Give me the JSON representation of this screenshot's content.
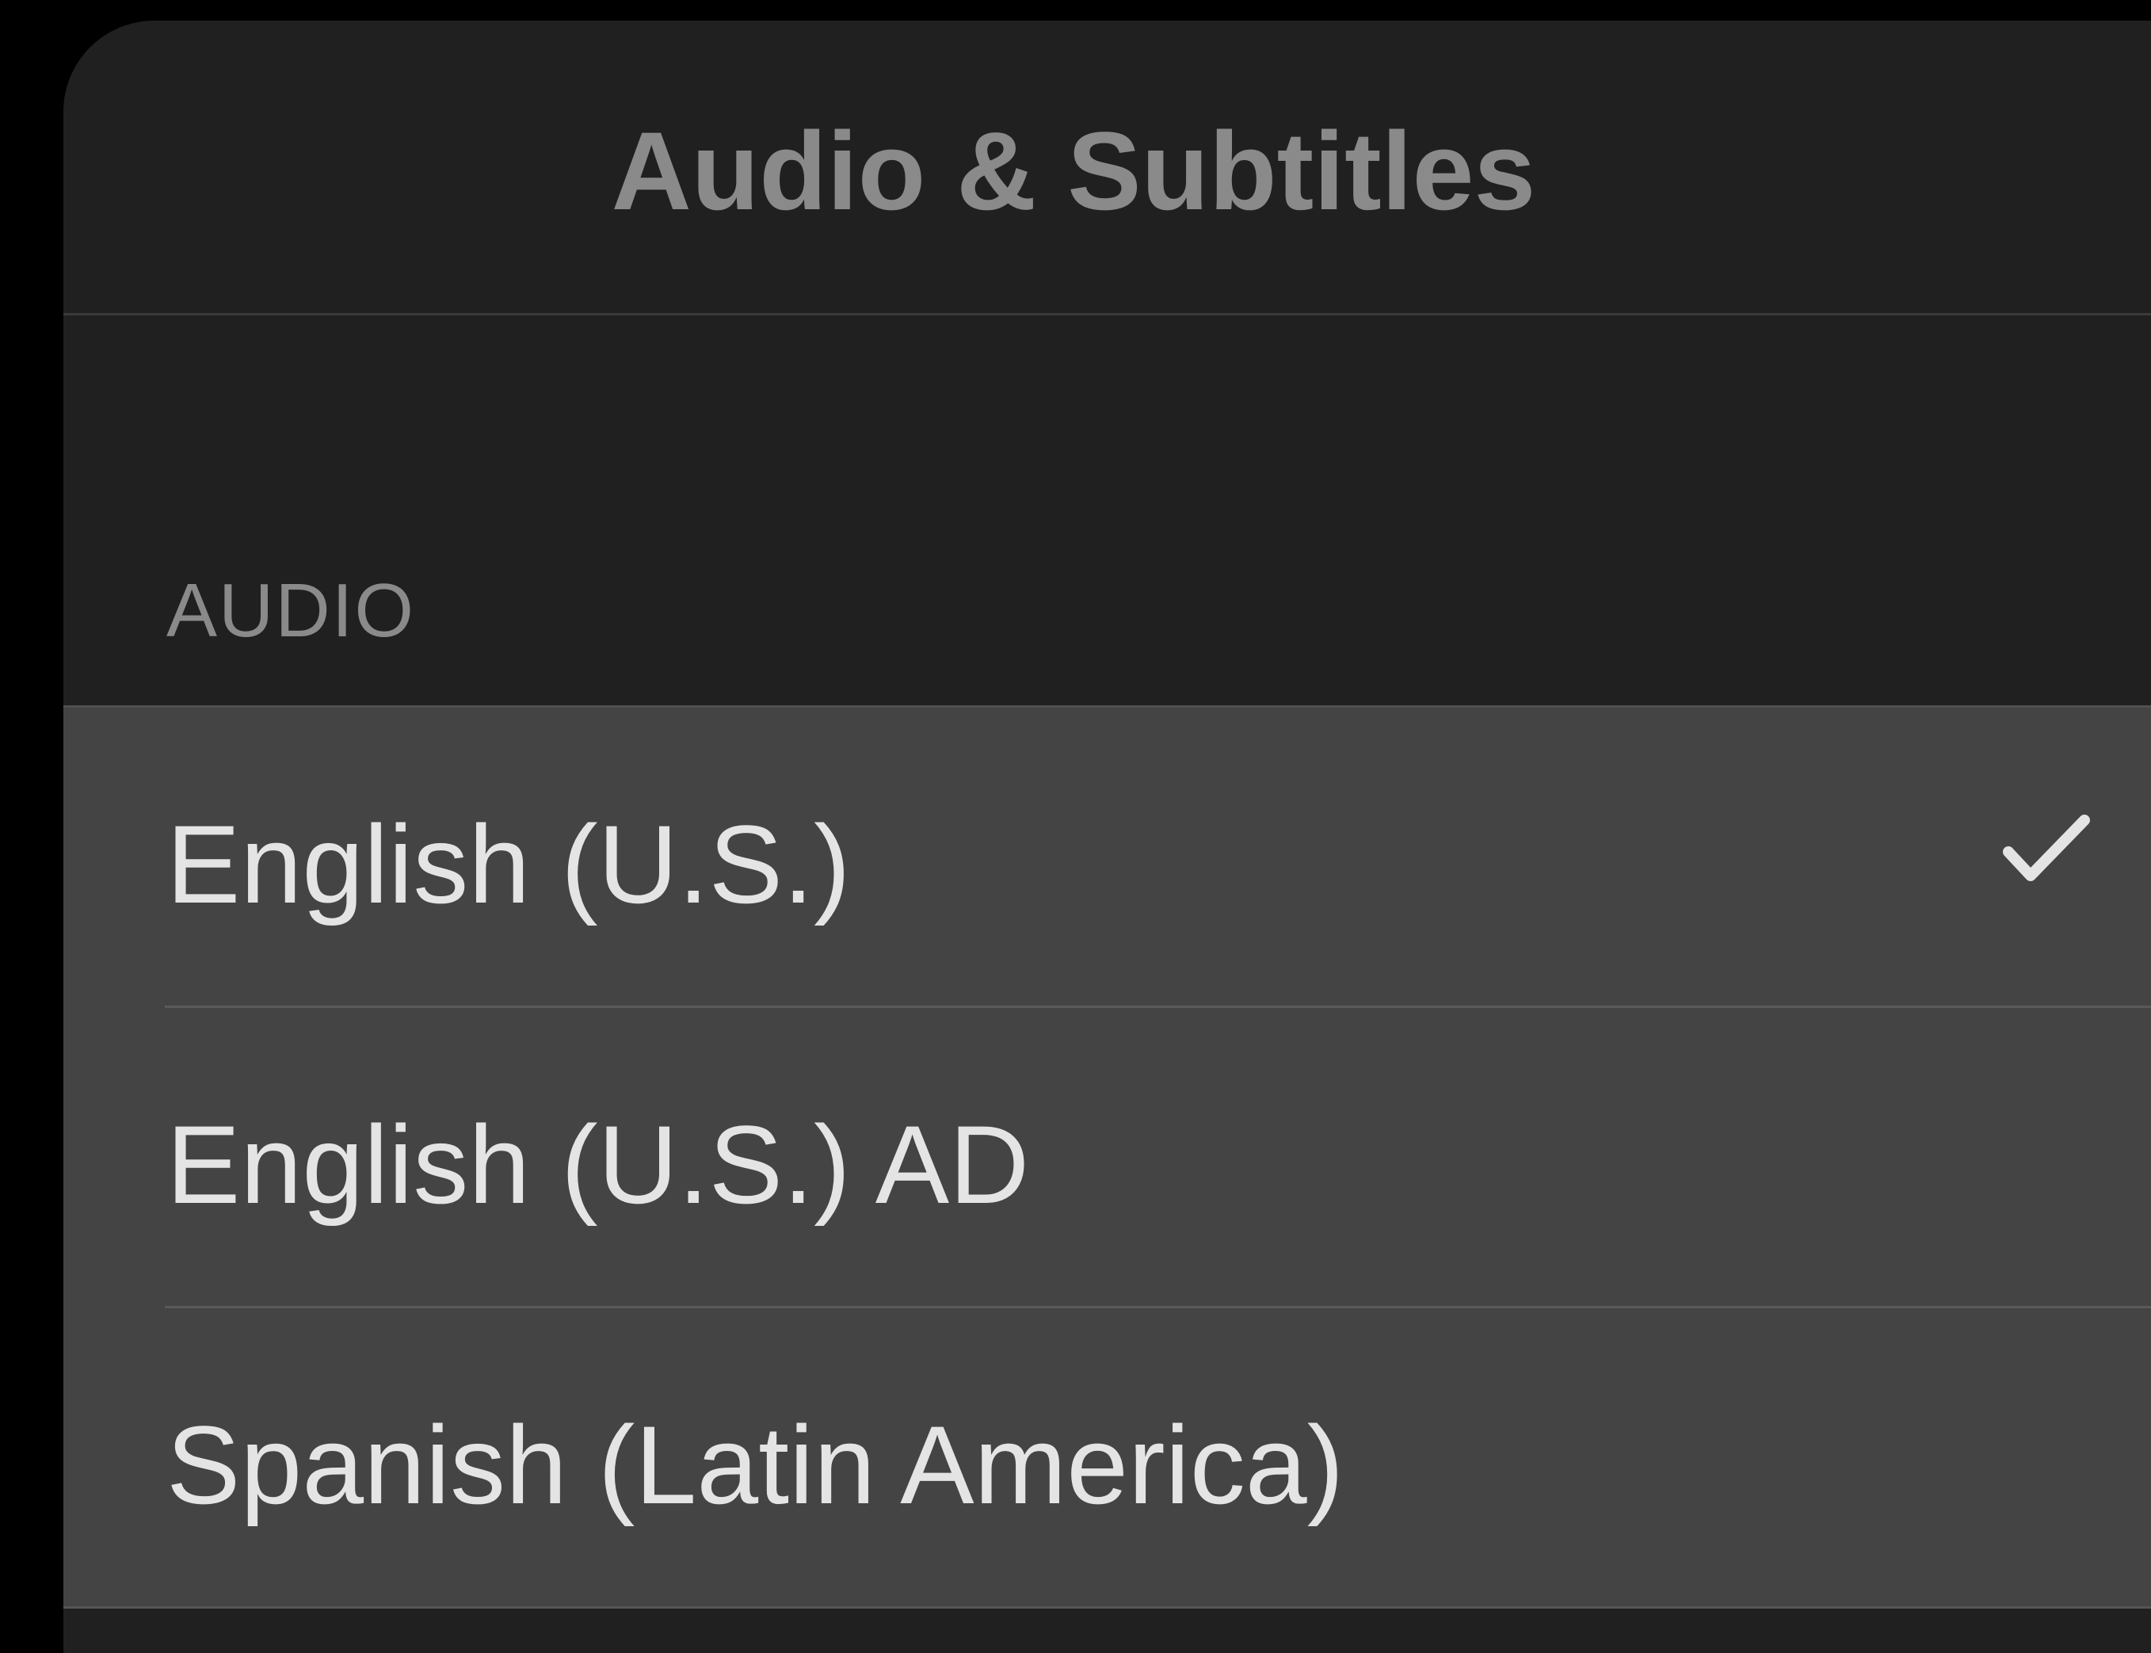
{
  "sheet": {
    "title": "Audio & Subtitles"
  },
  "audio": {
    "section_label": "AUDIO",
    "items": [
      {
        "label": "English (U.S.)",
        "selected": true
      },
      {
        "label": "English (U.S.) AD",
        "selected": false
      },
      {
        "label": "Spanish (Latin America)",
        "selected": false
      }
    ],
    "selected_icon": "checkmark-icon"
  },
  "colors": {
    "background": "#000000",
    "sheet": "#202020",
    "list": "#444444",
    "title_text": "#8a8a8a",
    "item_text": "#e4e4e4"
  }
}
